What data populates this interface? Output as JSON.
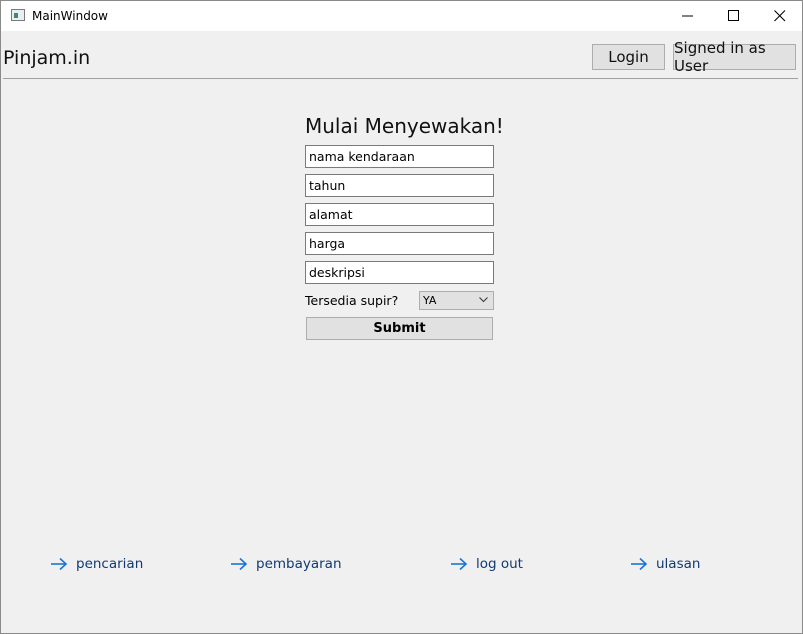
{
  "window": {
    "title": "MainWindow"
  },
  "header": {
    "brand": "Pinjam.in",
    "login_label": "Login",
    "signed_in_label": "Signed in as User"
  },
  "form": {
    "title": "Mulai Menyewakan!",
    "fields": [
      {
        "value": "nama kendaraan"
      },
      {
        "value": "tahun"
      },
      {
        "value": "alamat"
      },
      {
        "value": "harga"
      },
      {
        "value": "deskripsi"
      }
    ],
    "supir_label": "Tersedia supir?",
    "supir_selected": "YA",
    "submit_label": "Submit"
  },
  "nav": {
    "items": [
      {
        "label": "pencarian",
        "icon": "arrow-right-icon"
      },
      {
        "label": "pembayaran",
        "icon": "arrow-right-icon"
      },
      {
        "label": "log out",
        "icon": "arrow-right-icon"
      },
      {
        "label": "ulasan",
        "icon": "arrow-right-icon"
      }
    ]
  },
  "colors": {
    "background": "#f0f0f0",
    "link": "#0f3a73",
    "arrow": "#1b74d4"
  }
}
